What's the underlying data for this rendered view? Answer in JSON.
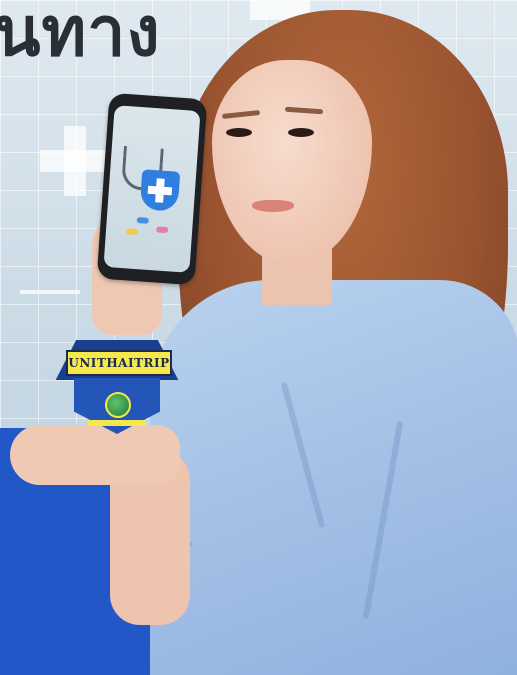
{
  "headline": "นทาง",
  "logo": {
    "text": "UNITHAITRIP"
  },
  "colors": {
    "headline": "#2a2e37",
    "background_top": "#d5e3ec",
    "background_bottom": "#2257c8",
    "logo_yellow": "#f4e84a",
    "logo_blue": "#1c3e8f"
  },
  "icons": {
    "phone_screen": [
      "stethoscope-icon",
      "medical-shield-icon",
      "pill-icon"
    ]
  }
}
